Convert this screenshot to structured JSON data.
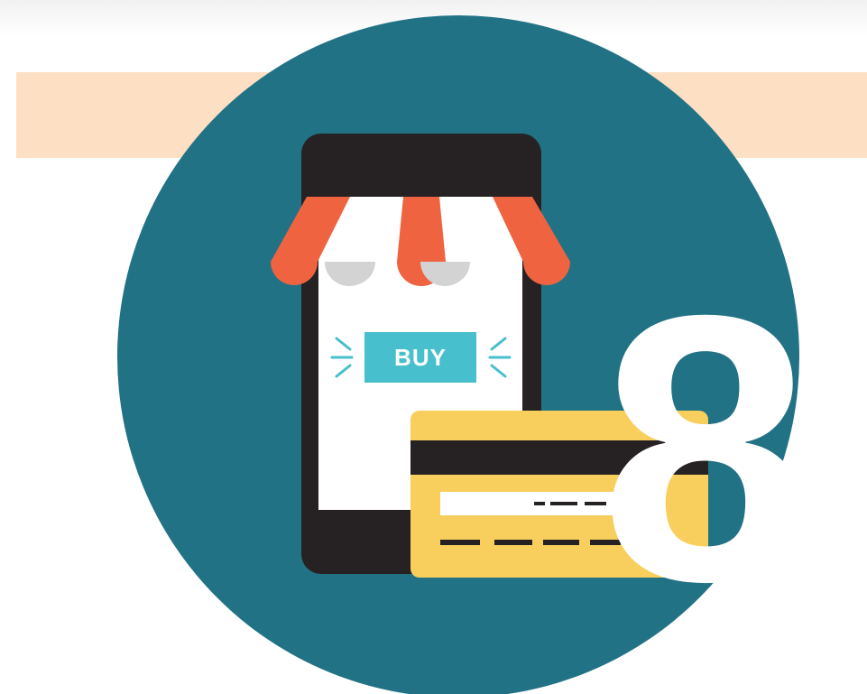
{
  "illustration": {
    "buy_button_label": "BUY",
    "step_number": "8",
    "icons": [
      "mobile-phone-icon",
      "shop-awning-icon",
      "credit-card-icon"
    ],
    "colors": {
      "background": "#ffffff",
      "band": "#fde0c3",
      "circle": "#227285",
      "phone_body": "#262223",
      "screen": "#ffffff",
      "awning_red": "#ef6340",
      "awning_white": "#ffffff",
      "scallop_gray": "#d3d3d3",
      "buy_button": "#48bfcc",
      "card": "#f8cf5c",
      "card_stripe": "#262223",
      "numeral": "#ffffff"
    }
  }
}
